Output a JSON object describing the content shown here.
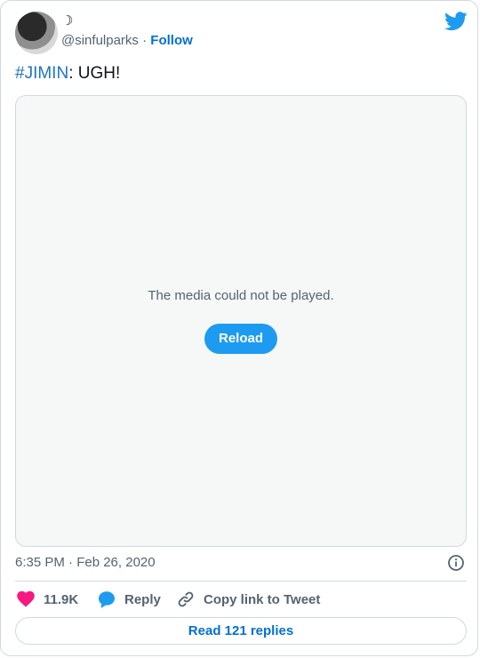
{
  "author": {
    "display_name": "☽",
    "handle": "@sinfulparks",
    "separator": "·",
    "follow_label": "Follow"
  },
  "tweet": {
    "hashtag": "#JIMIN",
    "text_rest": ": UGH!"
  },
  "media": {
    "error_message": "The media could not be played.",
    "reload_label": "Reload"
  },
  "meta": {
    "timestamp": "6:35 PM · Feb 26, 2020"
  },
  "actions": {
    "like_count": "11.9K",
    "reply_label": "Reply",
    "copy_label": "Copy link to Tweet"
  },
  "footer": {
    "read_replies_label": "Read 121 replies"
  },
  "colors": {
    "brand_blue": "#1d9bf0",
    "link_blue": "#006fd6",
    "like_pink": "#f91880",
    "text_gray": "#536471",
    "border": "#cfd9de"
  },
  "icons": [
    "twitter-bird-icon",
    "info-icon",
    "heart-icon",
    "reply-bubble-icon",
    "link-icon"
  ]
}
